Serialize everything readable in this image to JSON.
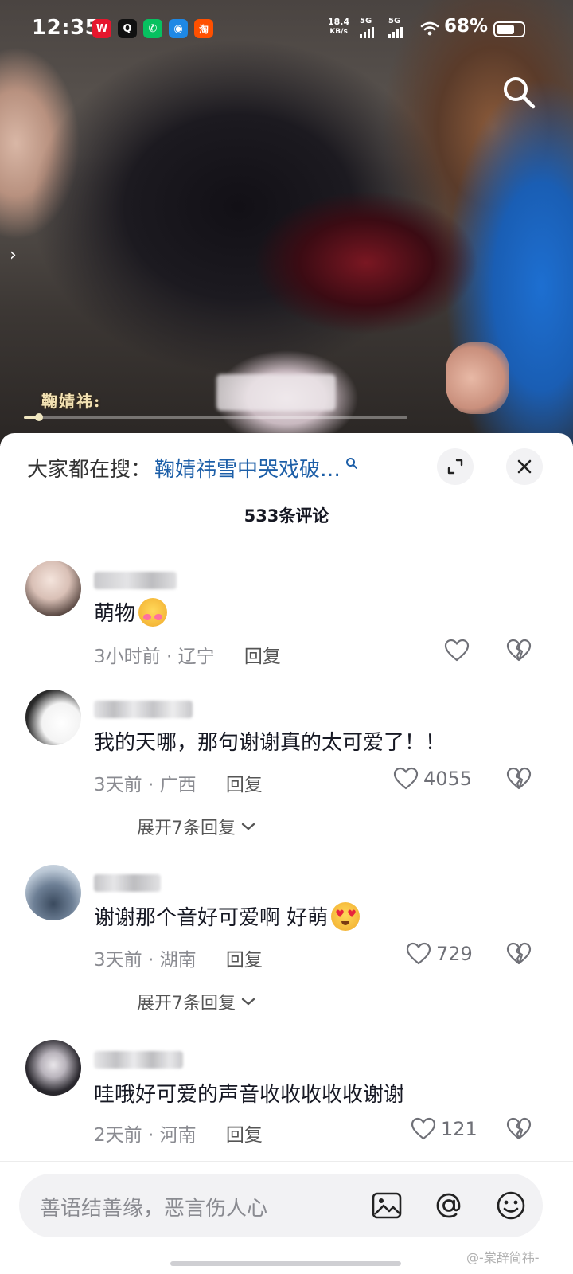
{
  "status_bar": {
    "time": "12:35",
    "net_speed_value": "18.4",
    "net_speed_unit": "KB/s",
    "signal_1": "5G",
    "signal_2": "5G",
    "battery": "68%",
    "battery_level": 0.68,
    "app_icons": [
      {
        "name": "weibo-icon",
        "glyph": "W",
        "color": "#e6162d"
      },
      {
        "name": "qq-icon",
        "glyph": "Q",
        "color": "#111111"
      },
      {
        "name": "wechat-icon",
        "glyph": "✆",
        "color": "#07c160"
      },
      {
        "name": "browser-icon",
        "glyph": "◉",
        "color": "#1e88e5"
      },
      {
        "name": "taobao-icon",
        "glyph": "淘",
        "color": "#ff5000"
      }
    ]
  },
  "video": {
    "subtitle": "鞠婧祎:",
    "progress": 0.04
  },
  "comments_panel": {
    "search_prefix": "大家都在搜：",
    "search_term": "鞠婧祎雪中哭戏破…",
    "comment_count": "533条评论",
    "link_color": "#1d5fa8"
  },
  "comments": [
    {
      "text": "萌物",
      "time": "3小时前",
      "location": "辽宁",
      "reply": "回复",
      "likes": "",
      "emoji": "hugging-face"
    },
    {
      "text": "我的天哪，那句谢谢真的太可爱了！！",
      "time": "3天前",
      "location": "广西",
      "reply": "回复",
      "likes": "4055",
      "expand": "展开7条回复"
    },
    {
      "text": "谢谢那个音好可爱啊 好萌",
      "time": "3天前",
      "location": "湖南",
      "reply": "回复",
      "likes": "729",
      "emoji": "heart-eyes-face",
      "expand": "展开7条回复"
    },
    {
      "text": "哇哦好可爱的声音收收收收收谢谢",
      "time": "2天前",
      "location": "河南",
      "reply": "回复",
      "likes": "121"
    }
  ],
  "input": {
    "placeholder": "善语结善缘，恶言伤人心"
  },
  "watermark": "@-棠辞简祎-"
}
